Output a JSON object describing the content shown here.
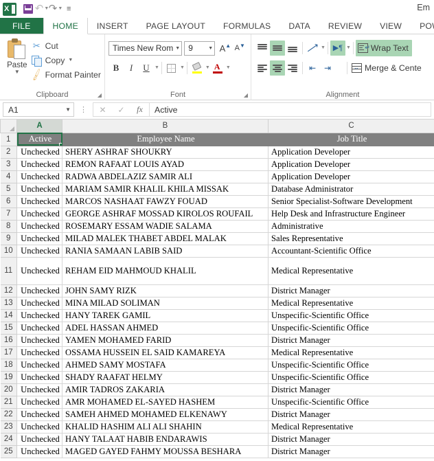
{
  "window": {
    "title": "Em"
  },
  "qat": {
    "items": [
      {
        "name": "excel-logo",
        "label": "X"
      },
      {
        "name": "save-icon",
        "label": "Save"
      },
      {
        "name": "undo-icon",
        "label": "Undo"
      },
      {
        "name": "redo-icon",
        "label": "Redo"
      },
      {
        "name": "customize-qat-icon",
        "label": "Customize Quick Access Toolbar"
      }
    ],
    "more_glyph": "≡"
  },
  "tabs": [
    {
      "label": "FILE",
      "active": false,
      "file": true
    },
    {
      "label": "HOME",
      "active": true,
      "file": false
    },
    {
      "label": "INSERT",
      "active": false,
      "file": false
    },
    {
      "label": "PAGE LAYOUT",
      "active": false,
      "file": false
    },
    {
      "label": "FORMULAS",
      "active": false,
      "file": false
    },
    {
      "label": "DATA",
      "active": false,
      "file": false
    },
    {
      "label": "REVIEW",
      "active": false,
      "file": false
    },
    {
      "label": "VIEW",
      "active": false,
      "file": false
    },
    {
      "label": "POWER Q",
      "active": false,
      "file": false
    }
  ],
  "ribbon": {
    "clipboard": {
      "group_label": "Clipboard",
      "paste_label": "Paste",
      "cut_label": "Cut",
      "copy_label": "Copy",
      "format_painter_label": "Format Painter"
    },
    "font": {
      "group_label": "Font",
      "font_name": "Times New Roma",
      "font_size": "9",
      "bold_label": "B",
      "italic_label": "I",
      "underline_label": "U",
      "grow_font_label": "A",
      "shrink_font_label": "A"
    },
    "alignment": {
      "group_label": "Alignment",
      "wrap_text_label": "Wrap Text",
      "merge_center_label": "Merge & Cente",
      "wrap_text_active": true,
      "middle_align_active": true,
      "center_align_active": true,
      "rtl_active": true
    }
  },
  "formula_bar": {
    "name_box": "A1",
    "cancel_glyph": "✕",
    "enter_glyph": "✓",
    "fx_label": "fx",
    "content": "Active"
  },
  "sheet": {
    "columns": [
      {
        "letter": "A",
        "selected": true
      },
      {
        "letter": "B",
        "selected": false
      },
      {
        "letter": "C",
        "selected": false
      }
    ],
    "header_row": {
      "number": "1",
      "a": "Active",
      "b": "Employee Name",
      "c": "Job Title"
    },
    "rows": [
      {
        "n": "2",
        "a": "Unchecked",
        "b": "SHERY ASHRAF SHOUKRY",
        "c": "Application Developer",
        "tall": false
      },
      {
        "n": "3",
        "a": "Unchecked",
        "b": "REMON RAFAAT LOUIS AYAD",
        "c": "Application Developer",
        "tall": false
      },
      {
        "n": "4",
        "a": "Unchecked",
        "b": "RADWA ABDELAZIZ SAMIR ALI",
        "c": "Application Developer",
        "tall": false
      },
      {
        "n": "5",
        "a": "Unchecked",
        "b": "MARIAM SAMIR KHALIL KHILA MISSAK",
        "c": "Database Administrator",
        "tall": false
      },
      {
        "n": "6",
        "a": "Unchecked",
        "b": "MARCOS NASHAAT FAWZY FOUAD",
        "c": "Senior Specialist-Software Development",
        "tall": false
      },
      {
        "n": "7",
        "a": "Unchecked",
        "b": "GEORGE ASHRAF MOSSAD KIROLOS ROUFAIL",
        "c": "Help Desk and Infrastructure Engineer",
        "tall": false
      },
      {
        "n": "8",
        "a": "Unchecked",
        "b": "ROSEMARY ESSAM WADIE SALAMA",
        "c": "Administrative",
        "tall": false
      },
      {
        "n": "9",
        "a": "Unchecked",
        "b": "MILAD MALEK THABET ABDEL MALAK",
        "c": "Sales Representative",
        "tall": false
      },
      {
        "n": "10",
        "a": "Unchecked",
        "b": "RANIA SAMAAN LABIB SAID",
        "c": "Accountant-Scientific Office",
        "tall": false
      },
      {
        "n": "11",
        "a": "Unchecked",
        "b": "REHAM EID MAHMOUD KHALIL",
        "c": "Medical Representative",
        "tall": true
      },
      {
        "n": "12",
        "a": "Unchecked",
        "b": "JOHN SAMY RIZK",
        "c": "District Manager",
        "tall": false
      },
      {
        "n": "13",
        "a": "Unchecked",
        "b": "MINA MILAD SOLIMAN",
        "c": "Medical Representative",
        "tall": false
      },
      {
        "n": "14",
        "a": "Unchecked",
        "b": "HANY TAREK GAMIL",
        "c": "Unspecific-Scientific Office",
        "tall": false
      },
      {
        "n": "15",
        "a": "Unchecked",
        "b": "ADEL HASSAN AHMED",
        "c": "Unspecific-Scientific Office",
        "tall": false
      },
      {
        "n": "16",
        "a": "Unchecked",
        "b": "YAMEN MOHAMED FARID",
        "c": "District Manager",
        "tall": false
      },
      {
        "n": "17",
        "a": "Unchecked",
        "b": "OSSAMA HUSSEIN EL SAID KAMAREYA",
        "c": "Medical Representative",
        "tall": false
      },
      {
        "n": "18",
        "a": "Unchecked",
        "b": "AHMED SAMY MOSTAFA",
        "c": "Unspecific-Scientific Office",
        "tall": false
      },
      {
        "n": "19",
        "a": "Unchecked",
        "b": "SHADY RAAFAT HELMY",
        "c": "Unspecific-Scientific Office",
        "tall": false
      },
      {
        "n": "20",
        "a": "Unchecked",
        "b": "AMIR TADROS ZAKARIA",
        "c": "District Manager",
        "tall": false
      },
      {
        "n": "21",
        "a": "Unchecked",
        "b": "AMR MOHAMED EL-SAYED HASHEM",
        "c": "Unspecific-Scientific Office",
        "tall": false
      },
      {
        "n": "22",
        "a": "Unchecked",
        "b": "SAMEH AHMED MOHAMED ELKENAWY",
        "c": "District Manager",
        "tall": false
      },
      {
        "n": "23",
        "a": "Unchecked",
        "b": "KHALID HASHIM ALI ALI SHAHIN",
        "c": "Medical Representative",
        "tall": false
      },
      {
        "n": "24",
        "a": "Unchecked",
        "b": "HANY TALAAT HABIB ENDARAWIS",
        "c": "District Manager",
        "tall": false
      },
      {
        "n": "25",
        "a": "Unchecked",
        "b": "MAGED GAYED FAHMY MOUSSA BESHARA",
        "c": "District Manager",
        "tall": false
      }
    ]
  },
  "colors": {
    "excel_green": "#217346",
    "header_fill": "#808080",
    "ribbon_active": "#a9d5b4"
  }
}
